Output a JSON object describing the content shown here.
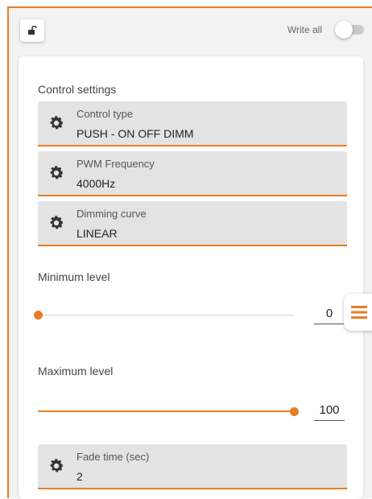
{
  "header": {
    "write_all_label": "Write all",
    "write_all_enabled": false,
    "lock_icon": "unlock-icon"
  },
  "control_settings": {
    "title": "Control settings",
    "items": [
      {
        "label": "Control type",
        "value": "PUSH - ON OFF DIMM",
        "icon": "gear-icon"
      },
      {
        "label": "PWM Frequency",
        "value": "4000Hz",
        "icon": "gear-icon"
      },
      {
        "label": "Dimming curve",
        "value": "LINEAR",
        "icon": "gear-icon"
      }
    ]
  },
  "minimum_level": {
    "title": "Minimum level",
    "value": "0",
    "fraction": 0.0
  },
  "maximum_level": {
    "title": "Maximum level",
    "value": "100",
    "fraction": 1.0
  },
  "fade_time": {
    "label": "Fade time (sec)",
    "value": "2",
    "icon": "gear-icon"
  },
  "menu_icon": "hamburger-menu-icon",
  "colors": {
    "accent": "#e87d26",
    "field_bg": "#e3e3e3",
    "page_bg": "#f2f2f2"
  }
}
